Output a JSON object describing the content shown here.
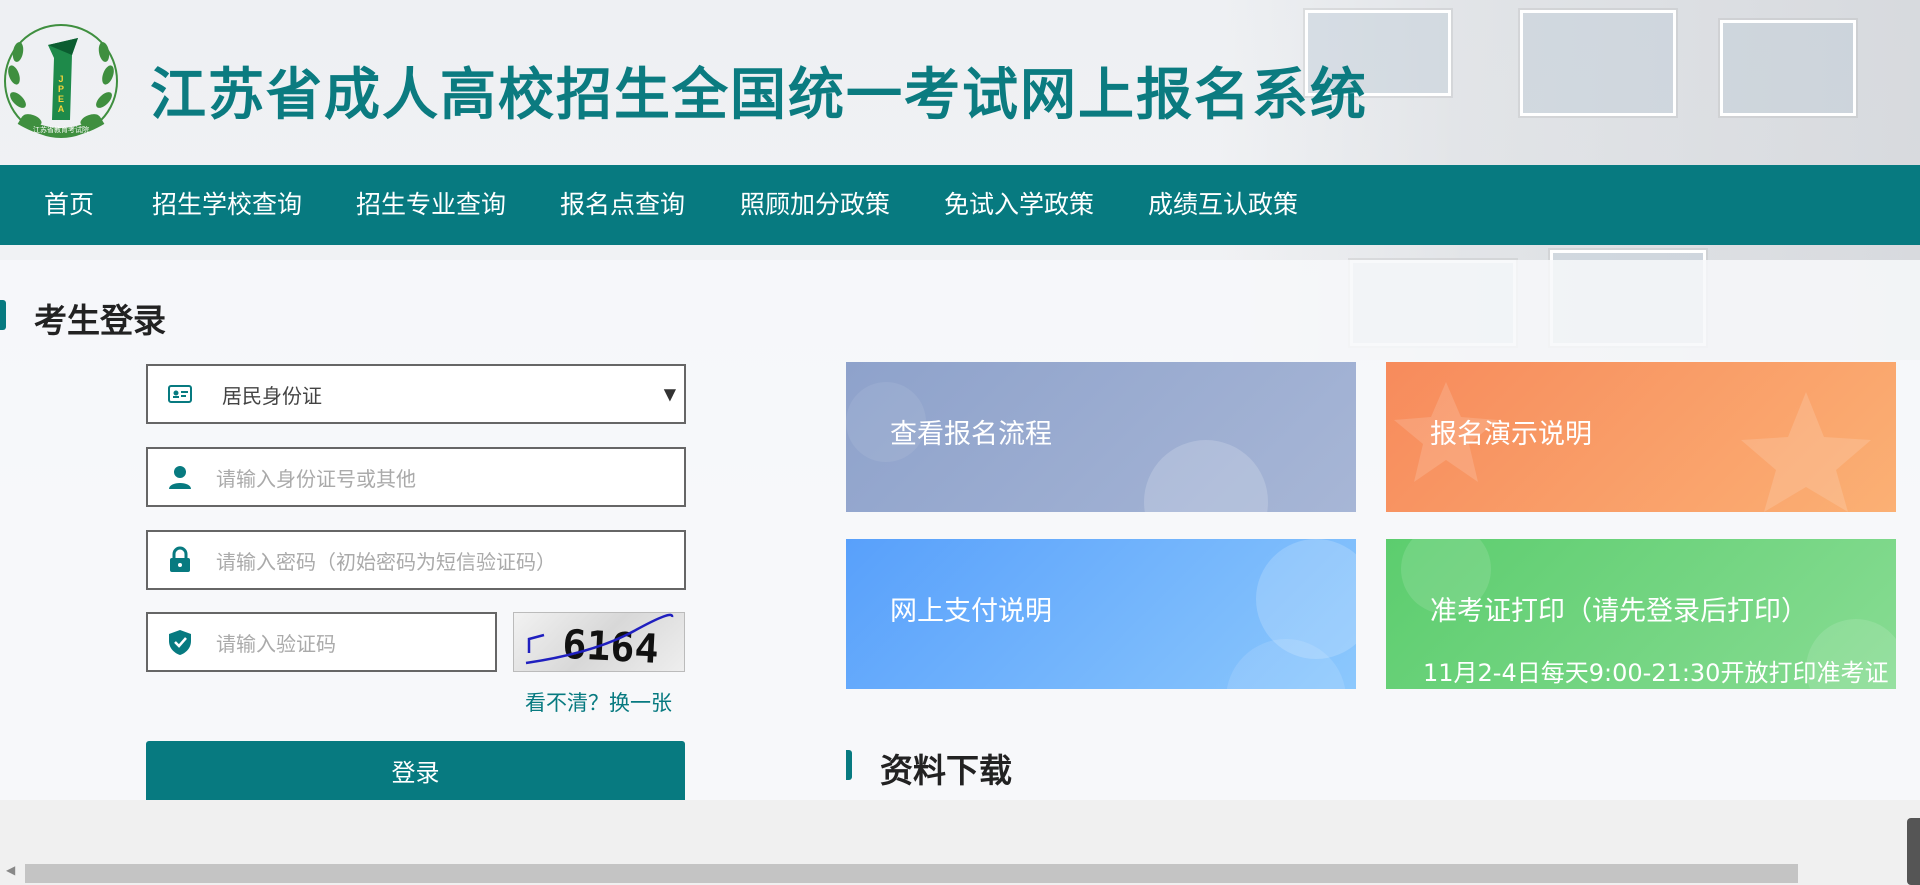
{
  "header": {
    "site_title": "江苏省成人高校招生全国统一考试网上报名系统",
    "logo_text": "江苏省教育考试院"
  },
  "nav": {
    "items": [
      "首页",
      "招生学校查询",
      "招生专业查询",
      "报名点查询",
      "照顾加分政策",
      "免试入学政策",
      "成绩互认政策"
    ]
  },
  "login": {
    "title": "考生登录",
    "id_type": {
      "value": "居民身份证"
    },
    "id_input": {
      "placeholder": "请输入身份证号或其他"
    },
    "password_input": {
      "placeholder": "请输入密码（初始密码为短信验证码）"
    },
    "captcha_input": {
      "placeholder": "请输入验证码"
    },
    "captcha_text": "6164",
    "refresh_link": "看不清？换一张",
    "login_button": "登录"
  },
  "cards": [
    {
      "label": "查看报名流程",
      "color": "#94a6cc"
    },
    {
      "label": "报名演示说明",
      "color": "#f89466"
    },
    {
      "label": "网上支付说明",
      "color": "#6aaafc"
    },
    {
      "label": "准考证打印（请先登录后打印）",
      "sub": "11月2-4日每天9:00-21:30开放打印准考证",
      "color": "#6cd37c"
    }
  ],
  "downloads": {
    "title": "资料下载"
  },
  "colors": {
    "primary": "#077a80",
    "title": "#0b7b80"
  }
}
